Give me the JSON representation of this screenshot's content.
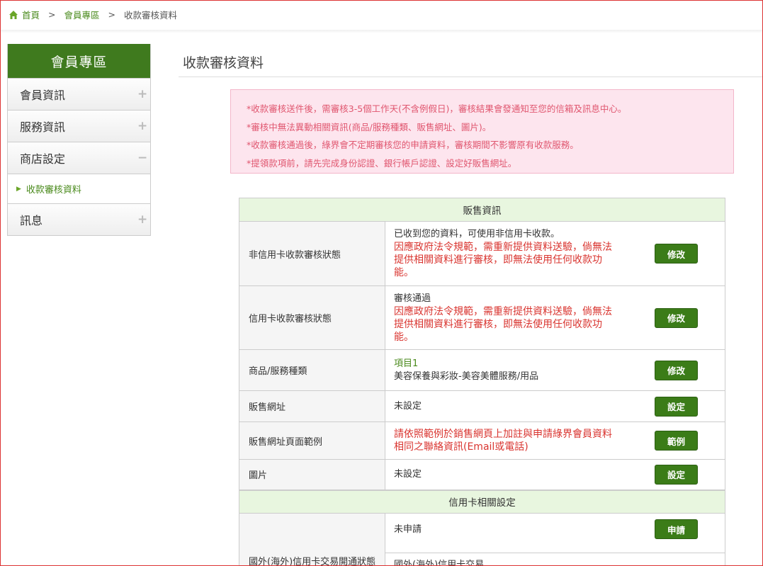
{
  "breadcrumb": {
    "home": "首頁",
    "sep1": ">",
    "member": "會員專區",
    "sep2": ">",
    "current": "收款審核資料"
  },
  "sidebar": {
    "header": "會員專區",
    "items": [
      {
        "label": "會員資訊",
        "toggle": "+"
      },
      {
        "label": "服務資訊",
        "toggle": "+"
      },
      {
        "label": "商店設定",
        "toggle": "−"
      },
      {
        "label": "訊息",
        "toggle": "+"
      }
    ],
    "sub_item": "收款審核資料"
  },
  "page": {
    "title": "收款審核資料"
  },
  "notice": [
    "*收款審核送件後，需審核3-5個工作天(不含例假日)，審核結果會發通知至您的信箱及訊息中心。",
    "*審核中無法異動相關資訊(商品/服務種類、販售網址、圖片)。",
    "*收款審核通過後，綠界會不定期審核您的申請資料，審核期間不影響原有收款服務。",
    "*提領款項前，請先完成身份認證、銀行帳戶認證、設定好販售網址。"
  ],
  "sales": {
    "header": "販售資訊",
    "rows": [
      {
        "label": "非信用卡收款審核狀態",
        "line1": "已收到您的資料，可使用非信用卡收款。",
        "warn": "因應政府法令規範，需重新提供資料送驗，倘無法提供相關資料進行審核，即無法使用任何收款功能。",
        "button": "修改"
      },
      {
        "label": "信用卡收款審核狀態",
        "line1": "審核通過",
        "warn": "因應政府法令規範，需重新提供資料送驗，倘無法提供相關資料進行審核，即無法使用任何收款功能。",
        "button": "修改"
      },
      {
        "label": "商品/服務種類",
        "item_title": "項目1",
        "item_desc": "美容保養與彩妝-美容美體服務/用品",
        "button": "修改"
      },
      {
        "label": "販售網址",
        "value": "未設定",
        "button": "設定"
      },
      {
        "label": "販售網址頁面範例",
        "example": "請依照範例於銷售網頁上加註與申請綠界會員資料相同之聯絡資訊(Email或電話)",
        "button": "範例"
      },
      {
        "label": "圖片",
        "value": "未設定",
        "button": "設定"
      }
    ]
  },
  "credit": {
    "header": "信用卡相關設定",
    "overseas": {
      "label": "國外(海外)信用卡交易開通狀態",
      "status": "未申請",
      "button": "申請",
      "next": "國外(海外)信用卡交易"
    }
  },
  "colors": {
    "brand_green": "#3f7a1e",
    "button_green": "#3b7c18",
    "notice_bg": "#fde5ee",
    "notice_text": "#e0566f",
    "warning_red": "#d9342f",
    "section_bg": "#e8f6df"
  }
}
